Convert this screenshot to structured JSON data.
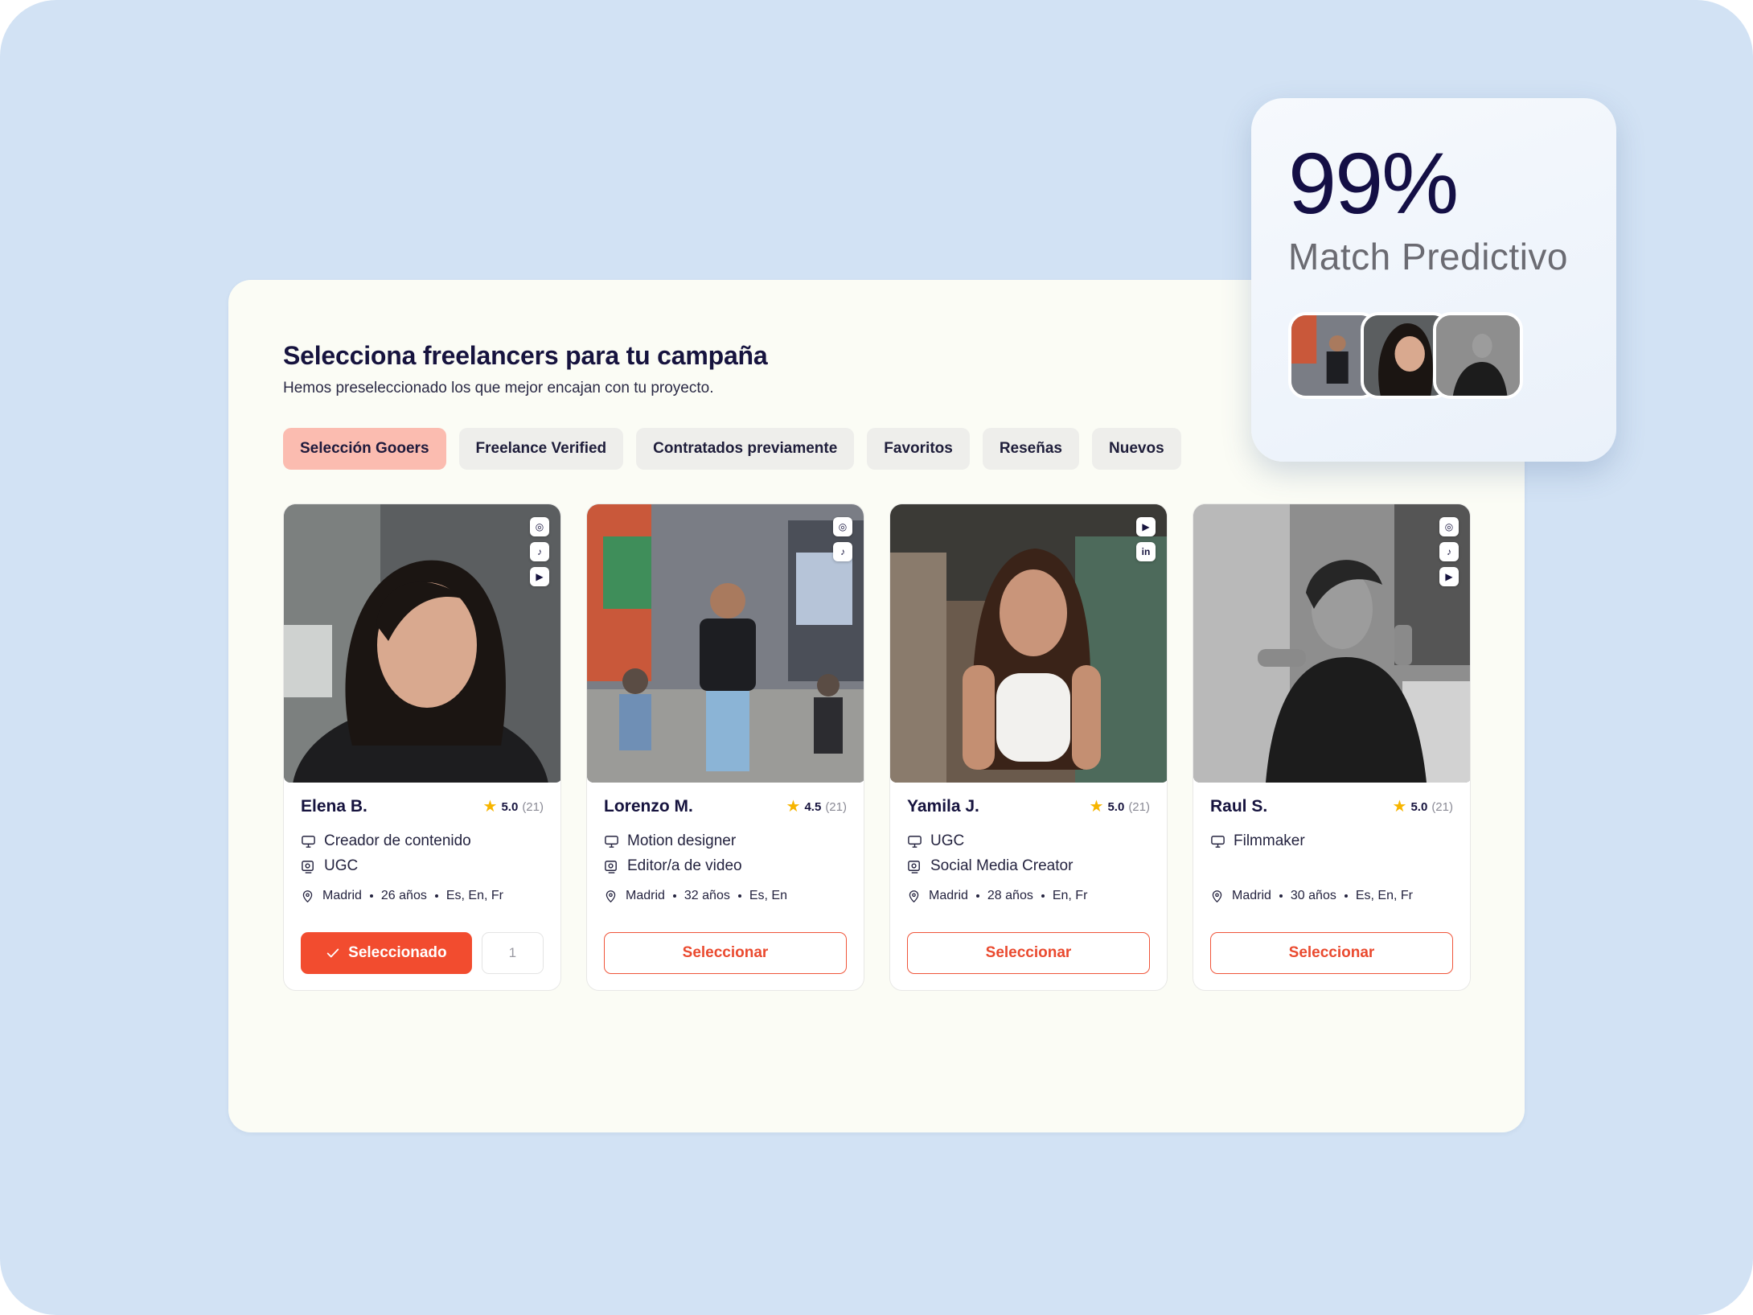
{
  "panel": {
    "title": "Selecciona freelancers para tu campaña",
    "subtitle": "Hemos preseleccionado los que mejor encajan con tu proyecto."
  },
  "tabs": [
    {
      "label": "Selección Gooers",
      "active": true
    },
    {
      "label": "Freelance Verified",
      "active": false
    },
    {
      "label": "Contratados previamente",
      "active": false
    },
    {
      "label": "Favoritos",
      "active": false
    },
    {
      "label": "Reseñas",
      "active": false
    },
    {
      "label": "Nuevos",
      "active": false
    }
  ],
  "freelancers": [
    {
      "name": "Elena B.",
      "rating": "5.0",
      "reviews": "(21)",
      "roles": [
        "Creador de contenido",
        "UGC"
      ],
      "city": "Madrid",
      "age": "26 años",
      "languages": "Es, En, Fr",
      "socials": [
        "IG",
        "TT",
        "YT"
      ],
      "selected": true,
      "selected_label": "Seleccionado",
      "quantity": "1"
    },
    {
      "name": "Lorenzo M.",
      "rating": "4.5",
      "reviews": "(21)",
      "roles": [
        "Motion designer",
        "Editor/a de video"
      ],
      "city": "Madrid",
      "age": "32 años",
      "languages": "Es, En",
      "socials": [
        "IG",
        "TT"
      ],
      "selected": false,
      "select_label": "Seleccionar"
    },
    {
      "name": "Yamila J.",
      "rating": "5.0",
      "reviews": "(21)",
      "roles": [
        "UGC",
        "Social Media Creator"
      ],
      "city": "Madrid",
      "age": "28 años",
      "languages": "En, Fr",
      "socials": [
        "YT",
        "in"
      ],
      "selected": false,
      "select_label": "Seleccionar"
    },
    {
      "name": "Raul S.",
      "rating": "5.0",
      "reviews": "(21)",
      "roles": [
        "Filmmaker"
      ],
      "city": "Madrid",
      "age": "30 años",
      "languages": "Es, En, Fr",
      "socials": [
        "IG",
        "TT",
        "YT"
      ],
      "selected": false,
      "select_label": "Seleccionar"
    }
  ],
  "match": {
    "percent": "99%",
    "label": "Match Predictivo"
  },
  "colors": {
    "accent": "#f24c2f",
    "active_tab": "#fbbcb0",
    "star": "#f7b500",
    "background": "#d2e2f4"
  }
}
